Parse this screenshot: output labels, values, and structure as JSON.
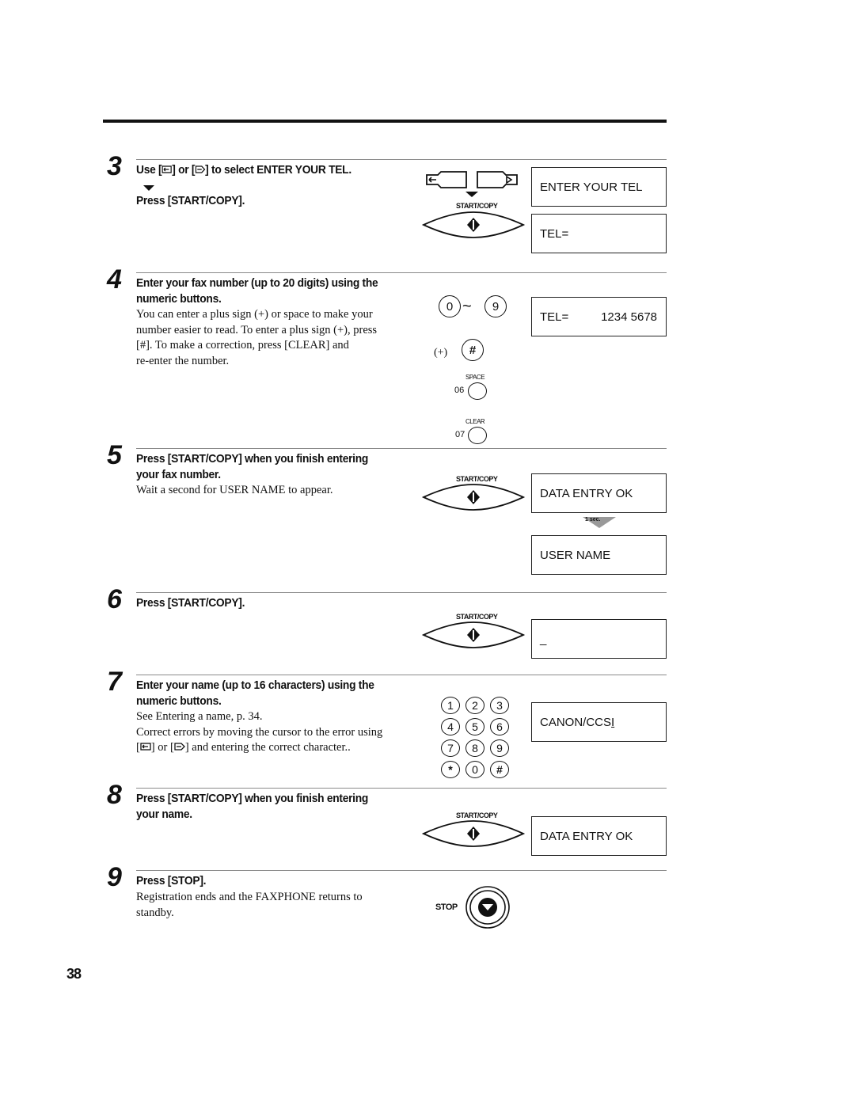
{
  "page_number": "38",
  "steps": [
    {
      "number": "3",
      "heading_line1": "Use [⇦] or [⇨] to select ENTER YOUR TEL.",
      "heading_parts": {
        "use": "Use [",
        "mid": "] or [",
        "end": "] to select ENTER YOUR TEL."
      },
      "heading_line2": "Press [START/COPY].",
      "displays": [
        "ENTER YOUR TEL",
        "TEL="
      ],
      "button_label": "START/COPY"
    },
    {
      "number": "4",
      "heading_line1": "Enter your fax number (up to 20 digits) using the",
      "heading_line2": "numeric buttons.",
      "body": [
        "You can enter a plus sign (+) or space to make your",
        "number easier to read. To enter a plus sign (+), press",
        "[#]. To make a correction, press [CLEAR] and",
        "re-enter the number."
      ],
      "display": {
        "label": "TEL=",
        "value": "1234 5678"
      },
      "keys": {
        "range_start": "0",
        "range_sep": "~",
        "range_end": "9",
        "plus_label": "(+)",
        "hash": "#",
        "space_label": "SPACE",
        "space_code": "06",
        "clear_label": "CLEAR",
        "clear_code": "07"
      }
    },
    {
      "number": "5",
      "heading_line1": "Press [START/COPY] when you finish entering",
      "heading_line2": "your fax number.",
      "body": [
        "Wait a second for USER NAME to appear."
      ],
      "displays": [
        "DATA ENTRY OK",
        "USER NAME"
      ],
      "arrow_label": "1 sec.",
      "button_label": "START/COPY"
    },
    {
      "number": "6",
      "heading_line1": "Press [START/COPY].",
      "display": "_",
      "button_label": "START/COPY"
    },
    {
      "number": "7",
      "heading_line1": "Enter your name (up to 16 characters) using the",
      "heading_line2": "numeric buttons.",
      "body": [
        "See Entering a name, p. 34.",
        "Correct errors by moving the cursor to the error using"
      ],
      "body_last": {
        "a": "[",
        "b": "] or [",
        "c": "] and entering the correct character.."
      },
      "display": {
        "text": "CANON/CCS",
        "cursor": "I"
      },
      "keypad": [
        "1",
        "2",
        "3",
        "4",
        "5",
        "6",
        "7",
        "8",
        "9",
        "*",
        "0",
        "#"
      ]
    },
    {
      "number": "8",
      "heading_line1": "Press [START/COPY] when you finish entering",
      "heading_line2": "your name.",
      "display": "DATA ENTRY OK",
      "button_label": "START/COPY"
    },
    {
      "number": "9",
      "heading_line1": "Press [STOP].",
      "body": [
        "Registration ends and the FAXPHONE returns to",
        "standby."
      ],
      "stop_label": "STOP"
    }
  ]
}
